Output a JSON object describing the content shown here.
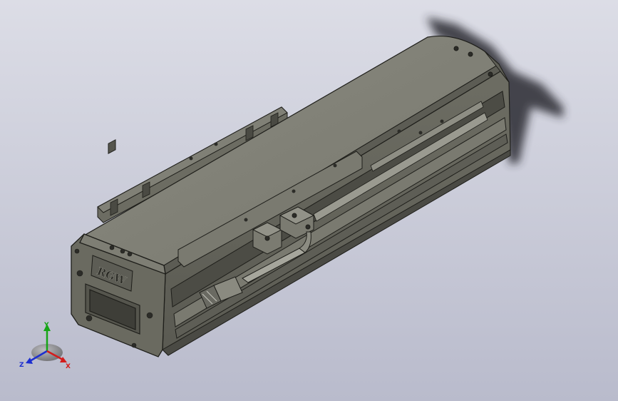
{
  "model": {
    "logo_text": "RGW",
    "body_color": "#6e6e64",
    "top_color": "#85857b",
    "edge_color": "#1e1e1a",
    "shadow_color": "#2b2c33",
    "background_top": "#dcdde6",
    "background_bottom": "#b9bbcc"
  },
  "triad": {
    "y_label": "Y",
    "z_label": "Z",
    "x_label": "X",
    "y_color": "#17a517",
    "z_color": "#1d2fd0",
    "x_color": "#d31c1c"
  }
}
